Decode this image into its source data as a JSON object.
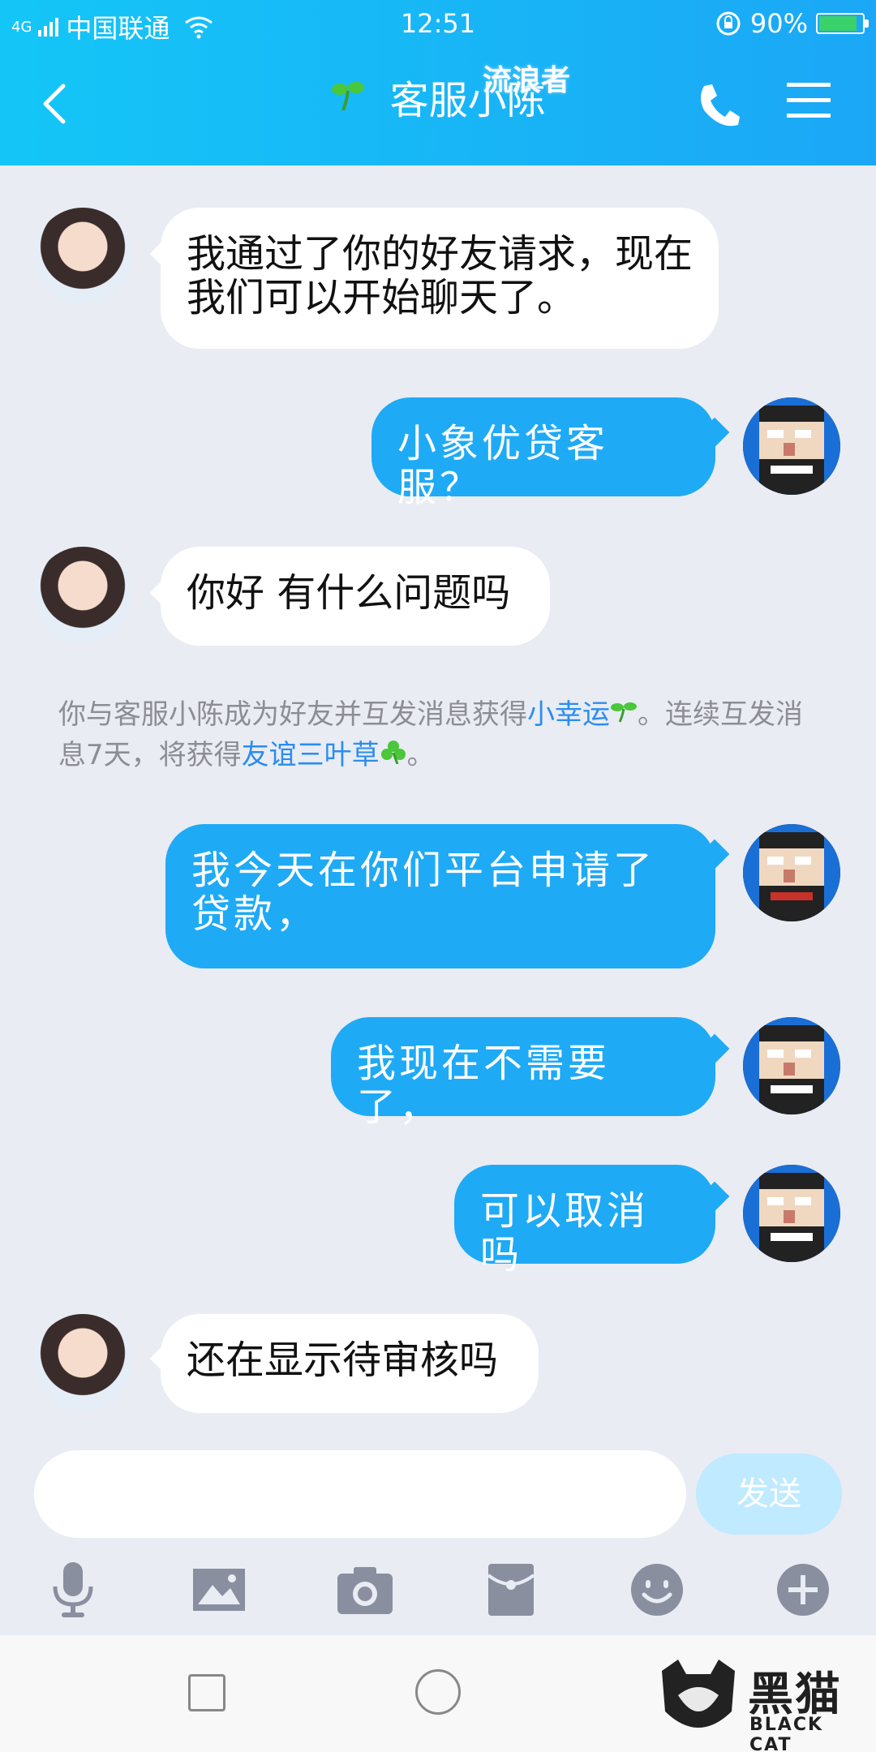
{
  "status_bar": {
    "network": "4G",
    "carrier": "中国联通",
    "time": "12:51",
    "battery": "90%"
  },
  "header": {
    "title": "客服小陈",
    "watermark": "流浪者"
  },
  "messages": [
    {
      "side": "in",
      "text": "我通过了你的好友请求，现在我们可以开始聊天了。"
    },
    {
      "side": "out",
      "text": "小象优贷客服？"
    },
    {
      "side": "in",
      "text": "你好 有什么问题吗"
    },
    {
      "side": "out",
      "text": "我今天在你们平台申请了贷款，"
    },
    {
      "side": "out",
      "text": "我现在不需要了，"
    },
    {
      "side": "out",
      "text": "可以取消吗"
    },
    {
      "side": "in",
      "text": "还在显示待审核吗"
    }
  ],
  "system_notice": {
    "part1": "你与客服小陈成为好友并互发消息获得",
    "link1": "小幸运",
    "part2": "。连续互发消息7天，将获得",
    "link2": "友谊三叶草",
    "part3": "。"
  },
  "composer": {
    "send_label": "发送"
  },
  "watermark_brand": {
    "cn": "黑猫",
    "en": "BLACK CAT"
  },
  "colors": {
    "header_start": "#14c6f7",
    "header_end": "#1ba7f6",
    "out_bubble": "#1faaf6",
    "link": "#2a8df0"
  }
}
